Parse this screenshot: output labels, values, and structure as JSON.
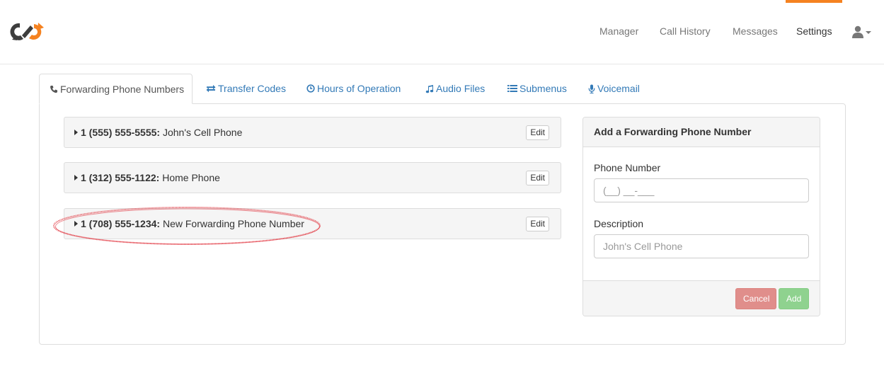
{
  "colors": {
    "accent_orange": "#f58220",
    "link_blue": "#337ab7",
    "logo_dark": "#3d3d3d",
    "highlight_red": "#e0303a",
    "cancel_red": "#e08e8b",
    "add_green": "#8fd28f"
  },
  "navbar": {
    "logo_icon": "brand-logo-icon",
    "links": [
      "Manager",
      "Call History",
      "Messages",
      "Settings"
    ],
    "active_link": "Settings",
    "user_icon": "user-icon",
    "user_caret_icon": "caret-down-icon"
  },
  "tabs": [
    {
      "label": "Forwarding Phone Numbers",
      "icon": "phone-icon",
      "active": true
    },
    {
      "label": "Transfer Codes",
      "icon": "transfer-arrows-icon",
      "active": false
    },
    {
      "label": "Hours of Operation",
      "icon": "clock-icon",
      "active": false
    },
    {
      "label": "Audio Files",
      "icon": "music-note-icon",
      "active": false
    },
    {
      "label": "Submenus",
      "icon": "list-icon",
      "active": false
    },
    {
      "label": "Voicemail",
      "icon": "microphone-icon",
      "active": false
    }
  ],
  "phones": [
    {
      "number": "1 (555) 555-5555:",
      "description": "John's Cell Phone",
      "edit_label": "Edit"
    },
    {
      "number": "1 (312) 555-1122:",
      "description": "Home Phone",
      "edit_label": "Edit"
    },
    {
      "number": "1 (708) 555-1234:",
      "description": "New Forwarding Phone Number",
      "edit_label": "Edit",
      "highlighted": true
    }
  ],
  "add_form": {
    "title": "Add a Forwarding Phone Number",
    "phone_label": "Phone Number",
    "phone_value": "",
    "phone_placeholder": "(__) __-___",
    "description_label": "Description",
    "description_value": "",
    "description_placeholder": "John's Cell Phone",
    "cancel_label": "Cancel",
    "add_label": "Add"
  }
}
